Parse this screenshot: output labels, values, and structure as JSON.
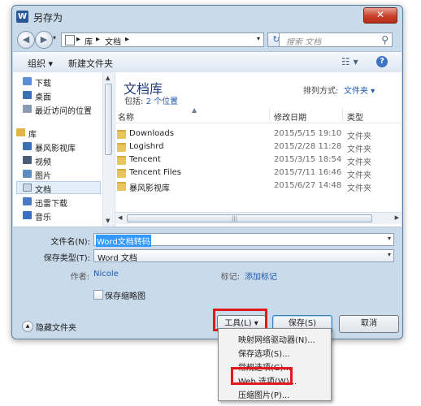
{
  "window": {
    "title": "另存为",
    "close_label": "✕",
    "app_icon": "W"
  },
  "navbar": {
    "back_icon": "◀",
    "forward_icon": "▶",
    "breadcrumb": [
      "库",
      "文档"
    ],
    "separators": [
      "▸",
      "▸",
      "▸"
    ],
    "search_placeholder": "搜索 文档"
  },
  "toolbar": {
    "organize_label": "组织 ▾",
    "new_folder_label": "新建文件夹"
  },
  "sidebar": {
    "items": [
      {
        "label": "下载",
        "icon": "download-icon",
        "color": "#5b8fd6"
      },
      {
        "label": "桌面",
        "icon": "desktop-icon",
        "color": "#3d6fb5"
      },
      {
        "label": "最近访问的位置",
        "icon": "recent-places-icon",
        "color": "#8a9ab0"
      },
      {
        "label": "库",
        "icon": "library-icon",
        "color": "#e2b646"
      },
      {
        "label": "暴风影视库",
        "icon": "video-library-icon",
        "color": "#3d6fb5"
      },
      {
        "label": "视频",
        "icon": "video-icon",
        "color": "#4a5d78"
      },
      {
        "label": "图片",
        "icon": "pictures-icon",
        "color": "#5f8cc0"
      },
      {
        "label": "文档",
        "icon": "documents-icon",
        "color": "#c9d6e8"
      },
      {
        "label": "迅雷下载",
        "icon": "thunder-download-icon",
        "color": "#4b79c4"
      },
      {
        "label": "音乐",
        "icon": "music-icon",
        "color": "#3b6fc2"
      }
    ]
  },
  "library": {
    "title": "文档库",
    "subtitle_prefix": "包括: ",
    "subtitle_link": "2 个位置",
    "arrange_label": "排列方式:",
    "arrange_value": "文件夹 ▾"
  },
  "columns": {
    "name": "名称",
    "date": "修改日期",
    "type": "类型"
  },
  "files": [
    {
      "name": "Downloads",
      "date": "2015/5/15 19:10",
      "type": "文件夹"
    },
    {
      "name": "Logishrd",
      "date": "2015/2/28 11:28",
      "type": "文件夹"
    },
    {
      "name": "Tencent",
      "date": "2015/3/15 18:54",
      "type": "文件夹"
    },
    {
      "name": "Tencent Files",
      "date": "2015/7/11 16:46",
      "type": "文件夹"
    },
    {
      "name": "暴风影视库",
      "date": "2015/6/27 14:48",
      "type": "文件夹"
    }
  ],
  "form": {
    "filename_label": "文件名(N):",
    "filename_value": "Word文档转码",
    "type_label": "保存类型(T):",
    "type_value": "Word 文档",
    "author_label": "作者:",
    "author_value": "Nicole",
    "tags_label": "标记:",
    "tags_value": "添加标记",
    "thumbnail_label": "保存缩略图"
  },
  "footer": {
    "hide_folders_label": "隐藏文件夹",
    "tools_label": "工具(L)  ▾",
    "save_label": "保存(S)",
    "cancel_label": "取消"
  },
  "tools_menu": {
    "items": [
      "映射网络驱动器(N)...",
      "保存选项(S)...",
      "常规选项(G)...",
      "Web 选项(W)...",
      "压缩图片(P)..."
    ]
  },
  "colors": {
    "highlight": "#e0191c",
    "link": "#1b5ab0",
    "selection": "#3399ff"
  }
}
